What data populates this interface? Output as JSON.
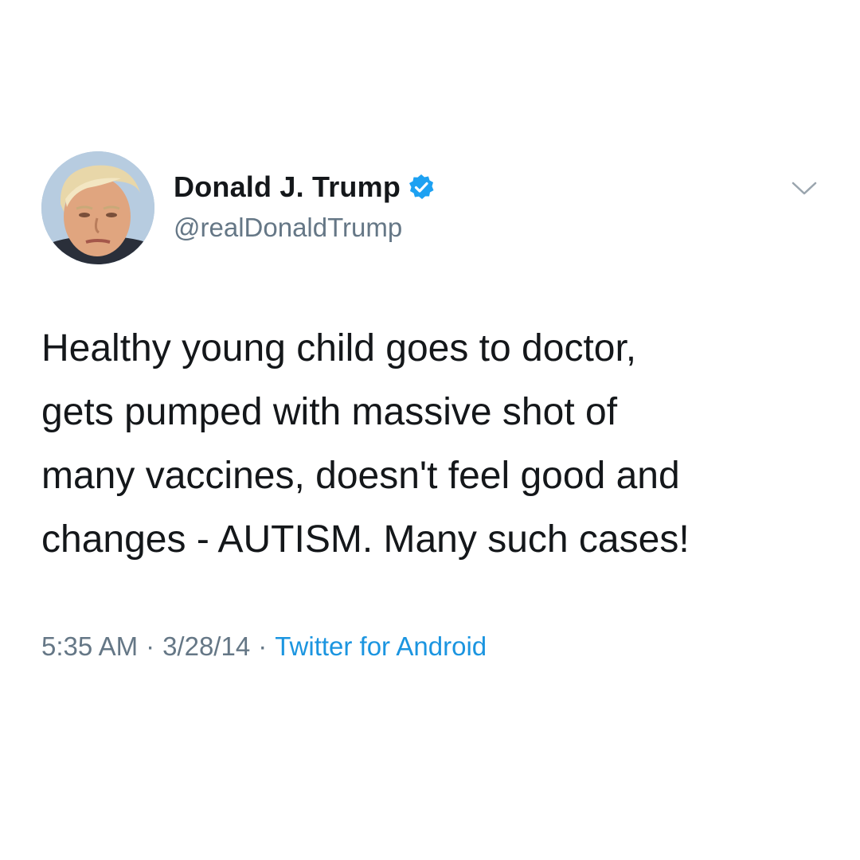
{
  "tweet": {
    "author": {
      "display_name": "Donald J. Trump",
      "handle": "@realDonaldTrump",
      "verified": true,
      "verified_icon": "verified-badge-icon",
      "avatar_alt": "profile photo"
    },
    "text": "Healthy young child goes to doctor,\ngets pumped with massive shot of\nmany vaccines, doesn't feel good and\nchanges - AUTISM. Many such cases!",
    "time": "5:35 AM",
    "date": "3/28/14",
    "separator": "·",
    "source": "Twitter for Android",
    "menu_icon": "chevron-down-icon"
  },
  "colors": {
    "text_primary": "#14171a",
    "text_secondary": "#657786",
    "link": "#1b95e0",
    "verified_blue": "#1da1f2"
  }
}
